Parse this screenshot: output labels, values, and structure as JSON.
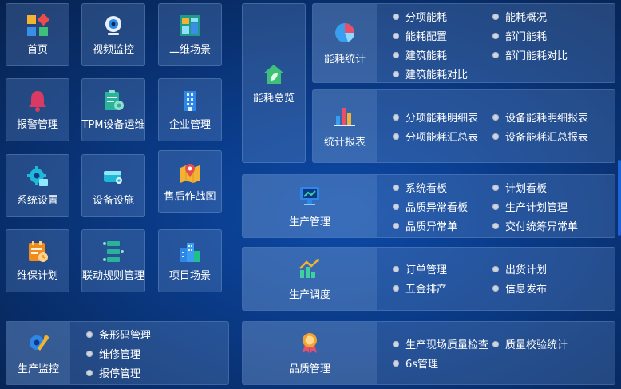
{
  "tiles": [
    {
      "key": "home",
      "label": "首页",
      "icon": "home-grid-icon"
    },
    {
      "key": "video",
      "label": "视频监控",
      "icon": "webcam-icon"
    },
    {
      "key": "scene2d",
      "label": "二维场景",
      "icon": "dashboard-icon"
    },
    {
      "key": "alarm",
      "label": "报警管理",
      "icon": "alarm-bell-icon"
    },
    {
      "key": "tpm",
      "label": "TPM设备运维",
      "icon": "clipboard-gear-icon"
    },
    {
      "key": "enterprise",
      "label": "企业管理",
      "icon": "building-icon"
    },
    {
      "key": "system",
      "label": "系统设置",
      "icon": "gear-screen-icon"
    },
    {
      "key": "equipment",
      "label": "设备设施",
      "icon": "server-device-icon"
    },
    {
      "key": "aftersales",
      "label": "售后作战图",
      "icon": "map-pin-icon"
    },
    {
      "key": "maintenance",
      "label": "维保计划",
      "icon": "calendar-clock-icon"
    },
    {
      "key": "linkage",
      "label": "联动规则管理",
      "icon": "flow-rules-icon"
    },
    {
      "key": "project",
      "label": "项目场景",
      "icon": "city-icon"
    }
  ],
  "energy_overview": {
    "label": "能耗总览",
    "icon": "leaf-house-icon"
  },
  "energy_stats": {
    "label": "能耗统计",
    "icon": "pie-chart-icon",
    "items": [
      "分项能耗",
      "能耗概况",
      "能耗配置",
      "部门能耗",
      "建筑能耗",
      "部门能耗对比",
      "建筑能耗对比"
    ]
  },
  "stat_report": {
    "label": "统计报表",
    "icon": "bar-chart-icon",
    "items": [
      "分项能耗明细表",
      "设备能耗明细报表",
      "分项能耗汇总表",
      "设备能耗汇总报表"
    ]
  },
  "production_mgmt": {
    "label": "生产管理",
    "icon": "monitor-chart-icon",
    "items": [
      "系统看板",
      "计划看板",
      "品质异常看板",
      "生产计划管理",
      "品质异常单",
      "交付统筹异常单"
    ]
  },
  "production_dispatch": {
    "label": "生产调度",
    "icon": "trend-chart-icon",
    "items": [
      "订单管理",
      "出货计划",
      "五金排产",
      "信息发布"
    ]
  },
  "production_monitor": {
    "label": "生产监控",
    "icon": "wrench-gear-icon",
    "items": [
      "条形码管理",
      "维修管理",
      "报停管理"
    ]
  },
  "quality_mgmt": {
    "label": "品质管理",
    "icon": "award-medal-icon",
    "items": [
      "生产现场质量检查",
      "质量校验统计",
      "6s管理"
    ]
  }
}
